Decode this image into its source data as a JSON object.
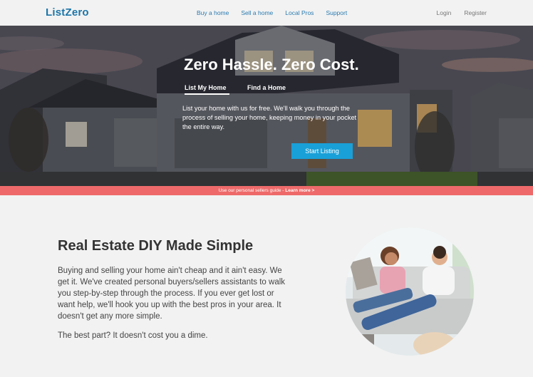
{
  "nav": {
    "logo": "ListZero",
    "links": [
      "Buy a home",
      "Sell a home",
      "Local Pros",
      "Support"
    ],
    "login": "Login",
    "register": "Register"
  },
  "hero": {
    "title": "Zero Hassle. Zero Cost.",
    "tabs": [
      "List My Home",
      "Find a Home"
    ],
    "description": "List your home with us for free. We'll walk you through the process of selling your home, keeping money in your pocket the entire way.",
    "cta": "Start Listing"
  },
  "banner": {
    "text": "Use our personal sellers guide - ",
    "link": "Learn more >"
  },
  "content": {
    "heading": "Real Estate DIY Made Simple",
    "paragraph1": "Buying and selling your home ain't cheap and it ain't easy. We get it. We've created personal buyers/sellers assistants to walk you step-by-step through the process. If you ever get lost or want help, we'll hook you up with the best pros in your area. It doesn't get any more simple.",
    "paragraph2": "The best part? It doesn't cost you a dime."
  },
  "colors": {
    "brand": "#1d75a8",
    "cta": "#19a0d8",
    "banner": "#ee6a6a",
    "background": "#f2f2f2"
  }
}
